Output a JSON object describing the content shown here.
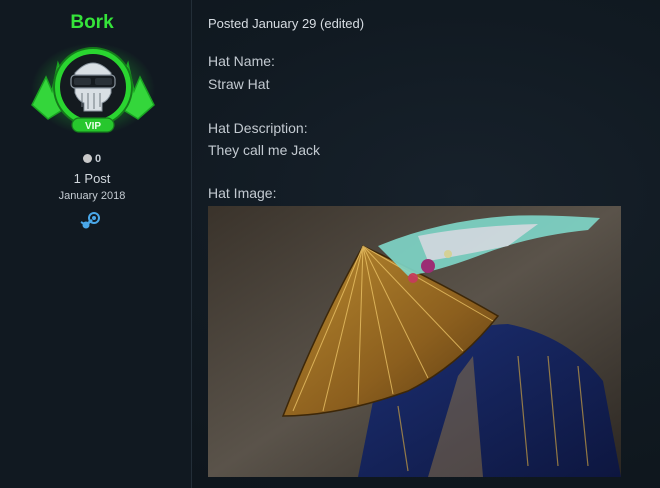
{
  "author": {
    "username": "Bork",
    "badge": "VIP",
    "reputation": "0",
    "post_count": "1 Post",
    "joined": "January 2018",
    "profile_icon": "steam-icon"
  },
  "post": {
    "posted": "Posted January 29 (edited)",
    "hat_name_label": "Hat Name:",
    "hat_name": "Straw Hat",
    "hat_description_label": "Hat Description:",
    "hat_description": "They call me Jack",
    "hat_image_label": "Hat Image:"
  },
  "colors": {
    "username": "#35e33a",
    "background": "#0f161d",
    "text": "#c3cad1"
  }
}
